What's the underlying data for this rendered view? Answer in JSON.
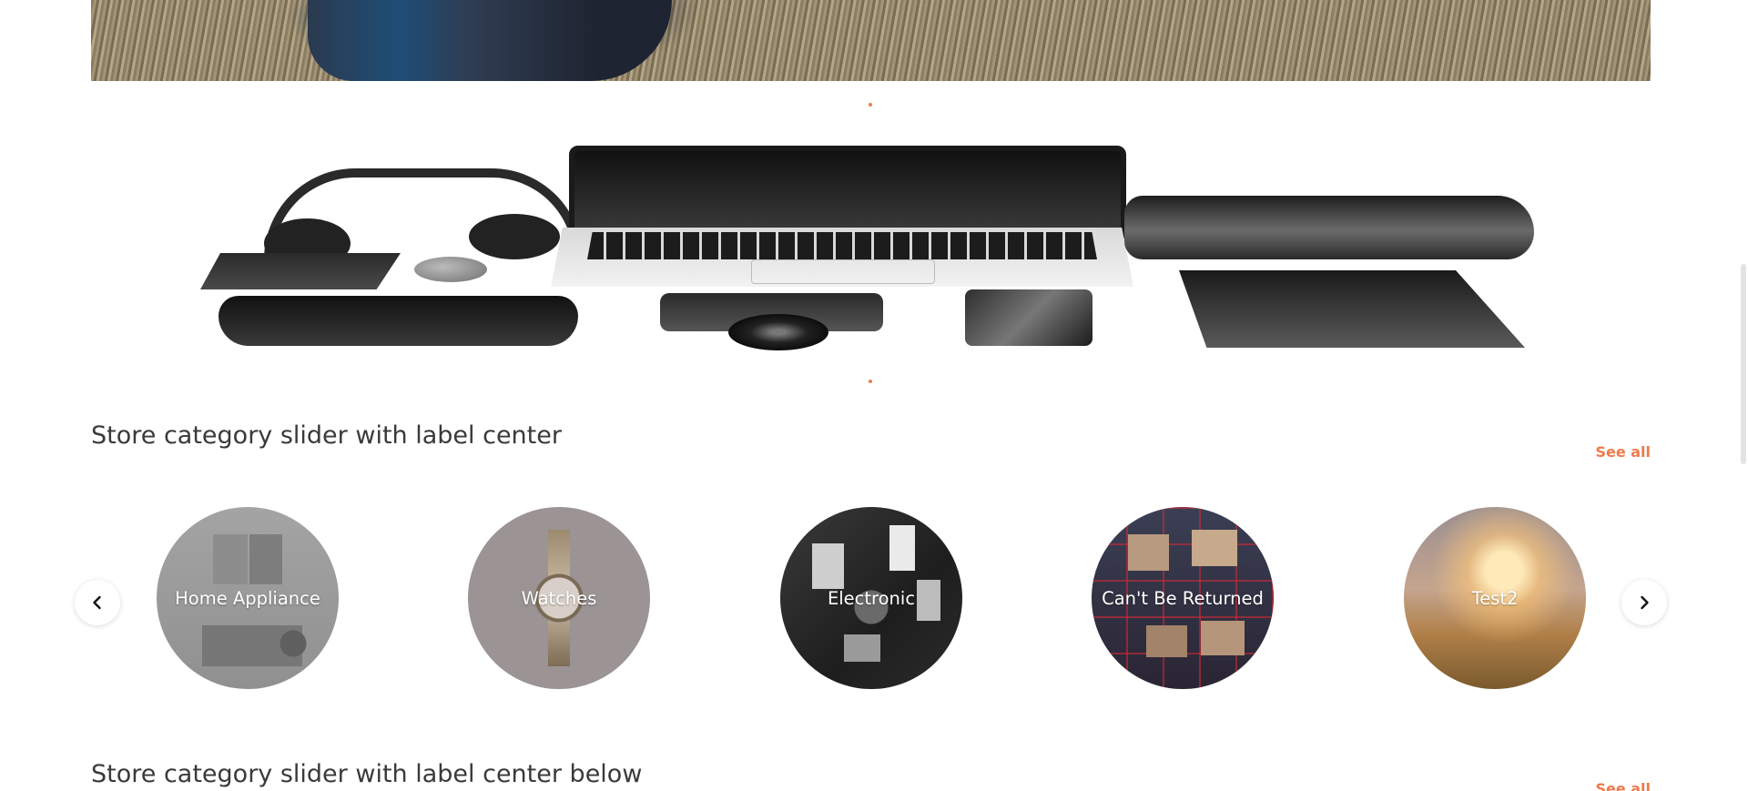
{
  "banner_dots": {
    "color": "#f07a4c"
  },
  "section1": {
    "title": "Store category slider with label center",
    "see_all": "See all"
  },
  "categories": [
    {
      "label": "Home Appliance"
    },
    {
      "label": "Watches"
    },
    {
      "label": "Electronic"
    },
    {
      "label": "Can't Be Returned"
    },
    {
      "label": "Test2"
    }
  ],
  "slider_nav": {
    "prev_icon": "chevron-left-icon",
    "next_icon": "chevron-right-icon"
  },
  "section2": {
    "title": "Store category slider with label center below",
    "see_all": "See all"
  },
  "colors": {
    "accent": "#f07a4c",
    "heading": "#3a3a3a"
  }
}
